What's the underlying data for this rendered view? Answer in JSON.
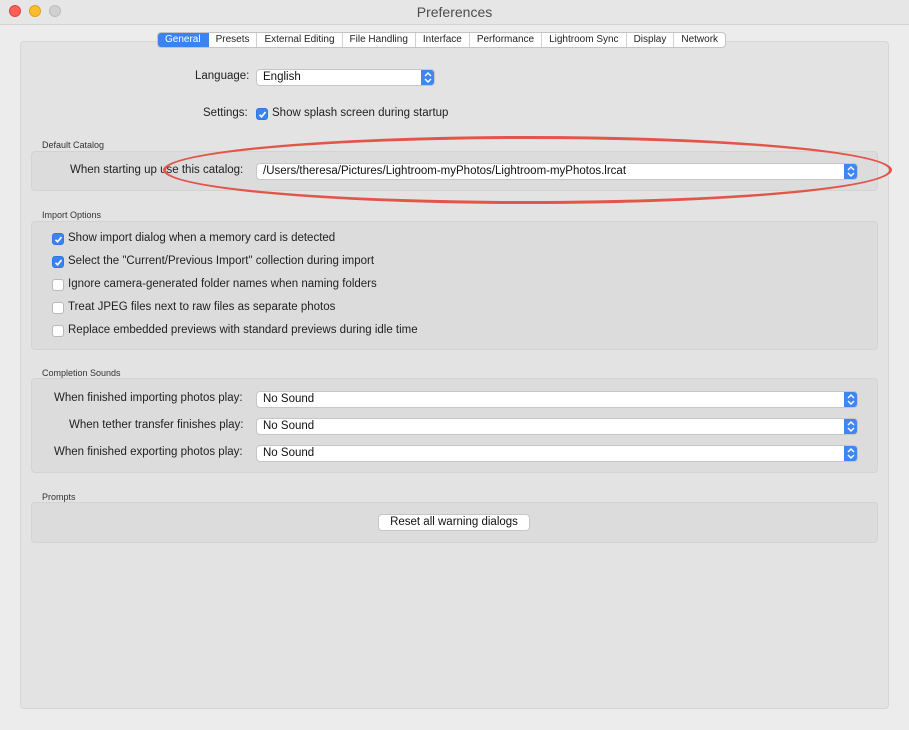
{
  "window": {
    "title": "Preferences"
  },
  "tabs": [
    {
      "label": "General"
    },
    {
      "label": "Presets"
    },
    {
      "label": "External Editing"
    },
    {
      "label": "File Handling"
    },
    {
      "label": "Interface"
    },
    {
      "label": "Performance"
    },
    {
      "label": "Lightroom Sync"
    },
    {
      "label": "Display"
    },
    {
      "label": "Network"
    }
  ],
  "general": {
    "language_label": "Language:",
    "language_value": "English",
    "settings_label": "Settings:",
    "splash_label": "Show splash screen during startup",
    "splash_checked": true
  },
  "default_catalog": {
    "title": "Default Catalog",
    "label": "When starting up use this catalog:",
    "value": "/Users/theresa/Pictures/Lightroom-myPhotos/Lightroom-myPhotos.lrcat"
  },
  "import_options": {
    "title": "Import Options",
    "items": [
      {
        "label": "Show import dialog when a memory card is detected",
        "checked": true
      },
      {
        "label": "Select the \"Current/Previous Import\" collection during import",
        "checked": true
      },
      {
        "label": "Ignore camera-generated folder names when naming folders",
        "checked": false
      },
      {
        "label": "Treat JPEG files next to raw files as separate photos",
        "checked": false
      },
      {
        "label": "Replace embedded previews with standard previews during idle time",
        "checked": false
      }
    ]
  },
  "completion_sounds": {
    "title": "Completion Sounds",
    "rows": [
      {
        "label": "When finished importing photos play:",
        "value": "No Sound"
      },
      {
        "label": "When tether transfer finishes play:",
        "value": "No Sound"
      },
      {
        "label": "When finished exporting photos play:",
        "value": "No Sound"
      }
    ]
  },
  "prompts": {
    "title": "Prompts",
    "reset_button": "Reset all warning dialogs"
  },
  "colors": {
    "accent": "#3b83f1",
    "annotation": "#e35449"
  }
}
